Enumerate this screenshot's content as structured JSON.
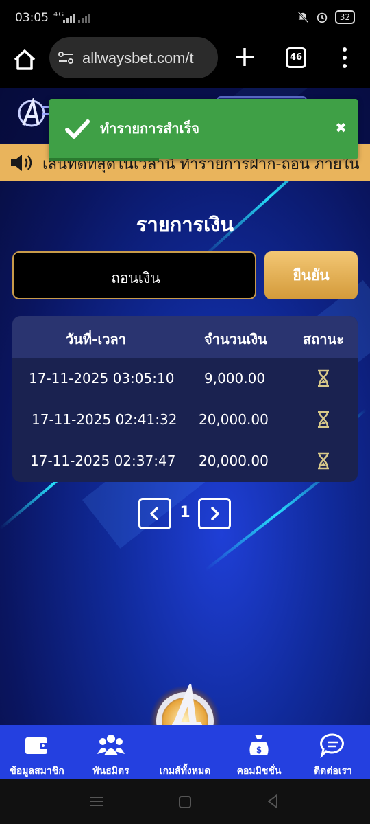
{
  "status_bar": {
    "time": "03:05",
    "network": "4G",
    "battery": "32"
  },
  "browser": {
    "url": "allwaysbet.com/t",
    "tab_count": "46"
  },
  "toast": {
    "message": "ทำรายการสำเร็จ",
    "close": "✖"
  },
  "marquee": {
    "text": "เล่นที่ดีที่สุดในเวลานี้ ทำรายการฝาก-ถอน ภายใน"
  },
  "page": {
    "title": "รายการเงิน",
    "select_value": "ถอนเงิน",
    "confirm_label": "ยืนยัน"
  },
  "table": {
    "headers": [
      "วันที่-เวลา",
      "จำนวนเงิน",
      "สถานะ"
    ],
    "rows": [
      {
        "datetime": "17-11-2025 03:05:10",
        "amount": "9,000.00",
        "status": "pending"
      },
      {
        "datetime": "17-11-2025 02:41:32",
        "amount": "20,000.00",
        "status": "pending"
      },
      {
        "datetime": "17-11-2025 02:37:47",
        "amount": "20,000.00",
        "status": "pending"
      }
    ]
  },
  "pagination": {
    "current": "1"
  },
  "bottom_nav": [
    {
      "label": "ข้อมูลสมาชิก",
      "icon": "wallet-icon"
    },
    {
      "label": "พันธมิตร",
      "icon": "group-icon"
    },
    {
      "label": "เกมส์ทั้งหมด",
      "icon": "avengers-logo-icon"
    },
    {
      "label": "คอมมิชชั่น",
      "icon": "money-bag-icon"
    },
    {
      "label": "ติดต่อเรา",
      "icon": "chat-icon"
    }
  ],
  "colors": {
    "accent_gold": "#e9b45c",
    "toast_green": "#3fa046",
    "nav_blue": "#2440e0"
  }
}
